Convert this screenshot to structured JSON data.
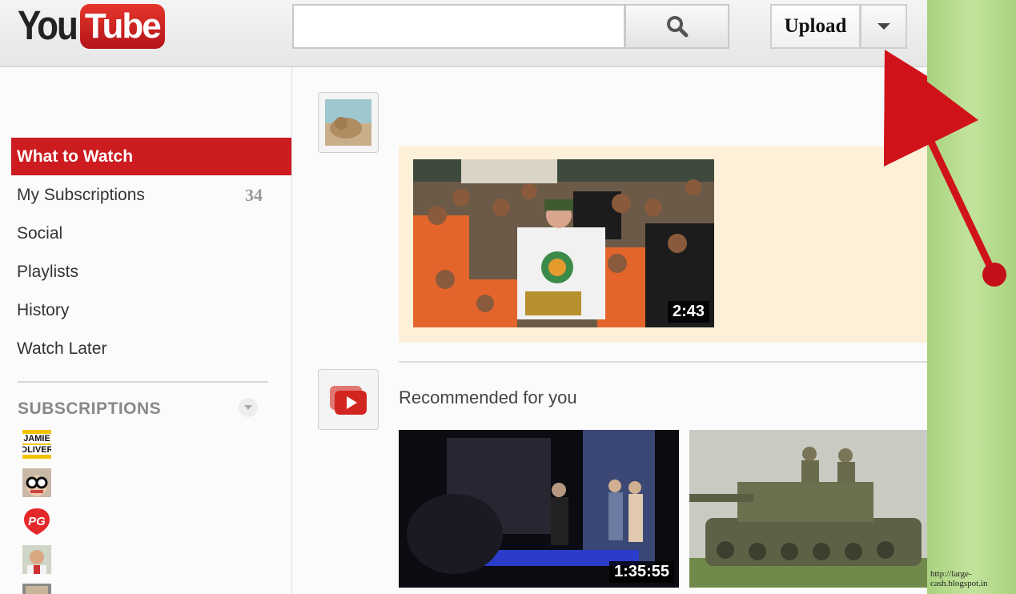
{
  "header": {
    "logo_you": "You",
    "logo_tube": "Tube",
    "search_placeholder": "",
    "upload_label": "Upload"
  },
  "sidebar": {
    "items": [
      {
        "label": "What to Watch",
        "active": true
      },
      {
        "label": "My Subscriptions",
        "count": "34"
      },
      {
        "label": "Social"
      },
      {
        "label": "Playlists"
      },
      {
        "label": "History"
      },
      {
        "label": "Watch Later"
      }
    ],
    "subscriptions_heading": "SUBSCRIPTIONS",
    "subscriptions": [
      {
        "name": "jamie-oliver",
        "logo_lines": [
          "JAMIE",
          "OLIVER"
        ]
      },
      {
        "name": "glasses-avatar"
      },
      {
        "name": "pg-avatar",
        "logo_text": "PG"
      },
      {
        "name": "man-avatar"
      }
    ]
  },
  "main": {
    "feed_video": {
      "duration": "2:43"
    },
    "recommended_title": "Recommended for you",
    "recommended_videos": [
      {
        "duration": "1:35:55",
        "subject": "concert"
      },
      {
        "subject": "tank"
      }
    ]
  },
  "watermark": "http://large-cash.blogspot.in",
  "colors": {
    "brand_red": "#cc1c1f",
    "feed_background": "#fdf0d8",
    "annotation_red": "#d0121a",
    "side_green": "#b5d98a"
  }
}
